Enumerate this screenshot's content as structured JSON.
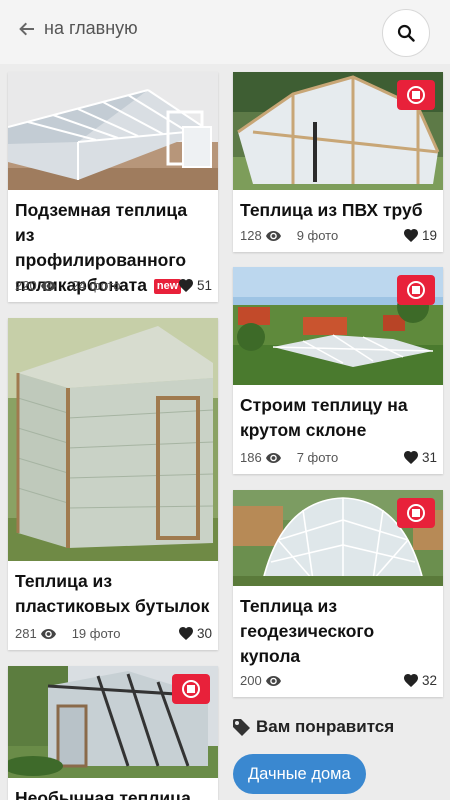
{
  "header": {
    "back_label": "на главную"
  },
  "cards": [
    {
      "title": "Подземная теплица из профилированного поликарбоната",
      "badge": "new",
      "views": "220",
      "photos": "24 фото",
      "likes": "51",
      "video": false
    },
    {
      "title": "Теплица из ПВХ труб",
      "views": "128",
      "photos": "9 фото",
      "likes": "19",
      "video": true
    },
    {
      "title": "Строим теплицу на крутом склоне",
      "views": "186",
      "photos": "7 фото",
      "likes": "31",
      "video": true
    },
    {
      "title": "Теплица из пластиковых бутылок",
      "views": "281",
      "photos": "19 фото",
      "likes": "30",
      "video": false
    },
    {
      "title": "Теплица из геодезического купола",
      "views": "200",
      "photos": "",
      "likes": "32",
      "video": true
    },
    {
      "title": "Необычная теплица",
      "video": true
    }
  ],
  "recommend": {
    "label": "Вам понравится",
    "pill": "Дачные дома"
  },
  "colors": {
    "accent": "#e8213a",
    "pill": "#3a88d0",
    "background": "#ececec"
  }
}
